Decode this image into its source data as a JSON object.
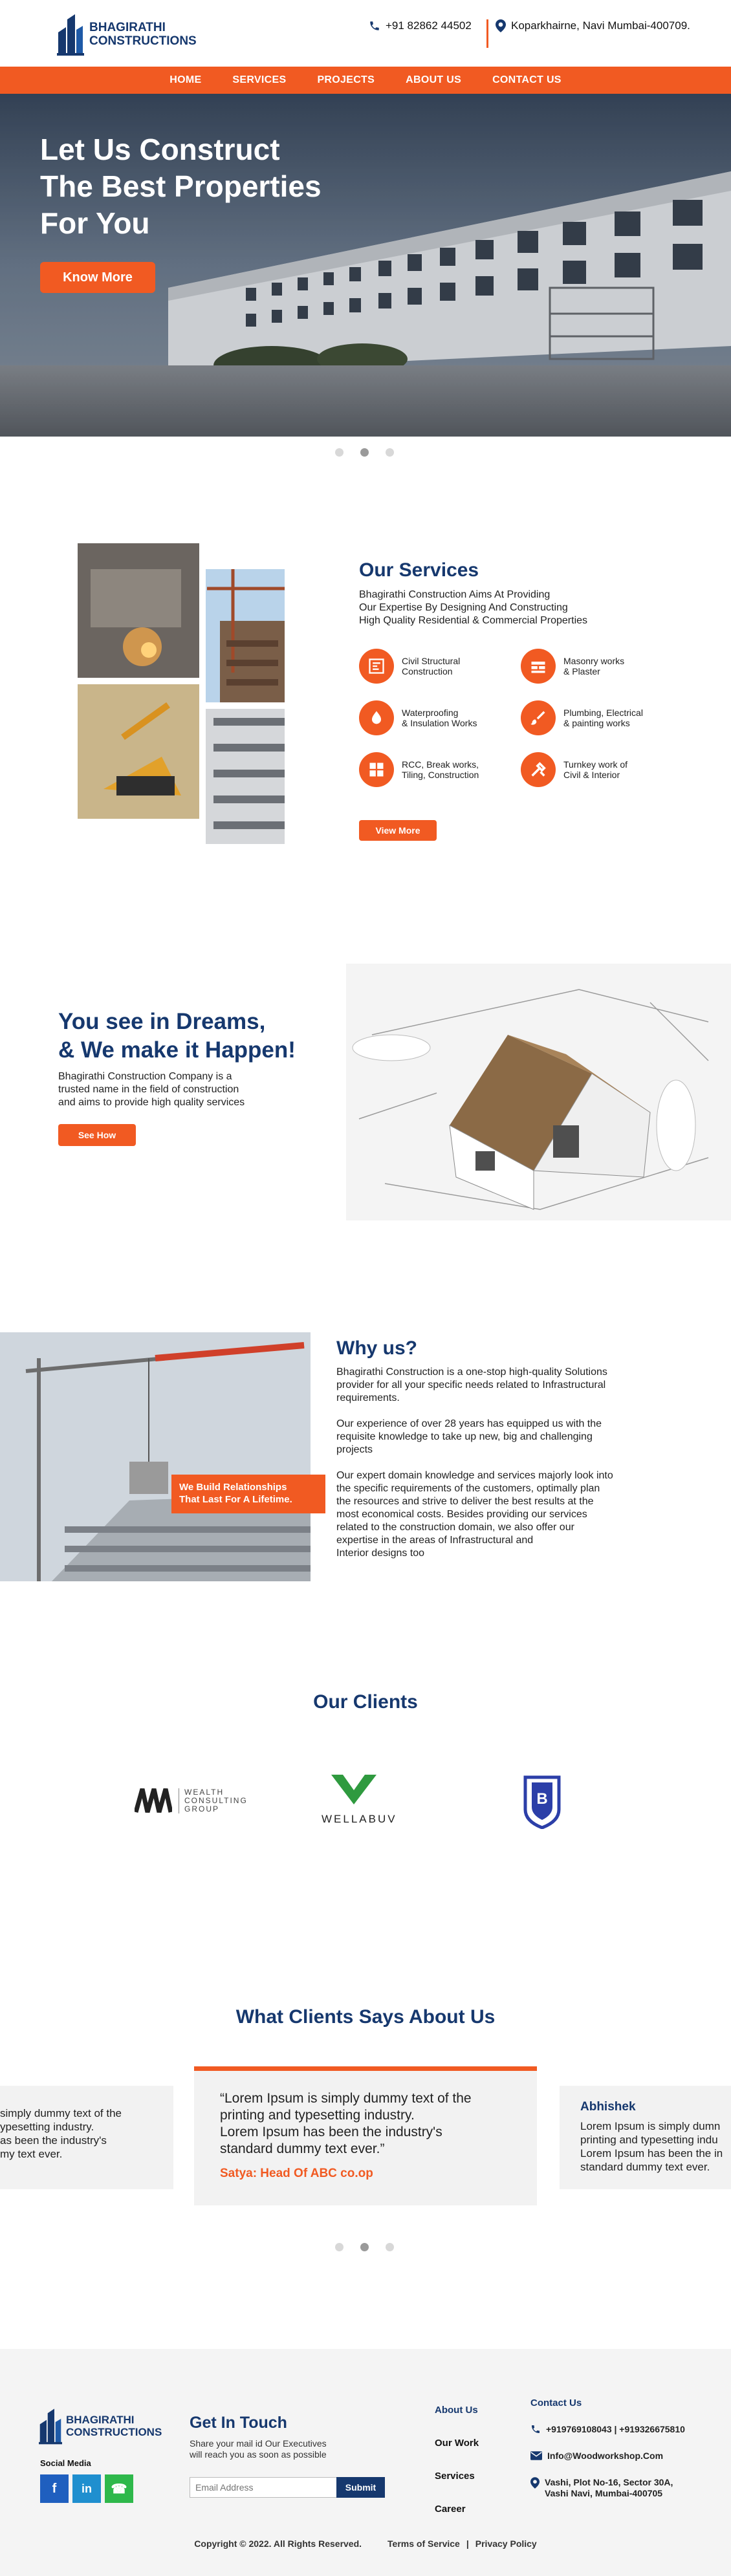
{
  "header": {
    "brand_line1": "BHAGIRATHI",
    "brand_line2": "CONSTRUCTIONS",
    "phone": "+91 82862 44502",
    "location": "Koparkhairne, Navi Mumbai-400709."
  },
  "nav": [
    "HOME",
    "SERVICES",
    "PROJECTS",
    "ABOUT US",
    "CONTACT US"
  ],
  "hero": {
    "title_lines": [
      "Let Us Construct",
      "The Best Properties",
      "For You"
    ],
    "cta": "Know More",
    "slides": 3,
    "active_slide": 2
  },
  "services": {
    "title": "Our Services",
    "intro_lines": [
      "Bhagirathi Construction Aims At Providing",
      "Our Expertise By Designing And Constructing",
      "High Quality Residential & Commercial Properties"
    ],
    "items": [
      {
        "label_lines": [
          "Civil Structural",
          "Construction"
        ],
        "icon": "blueprint-icon"
      },
      {
        "label_lines": [
          "Masonry works",
          "& Plaster"
        ],
        "icon": "brick-icon"
      },
      {
        "label_lines": [
          "Waterproofing",
          "& Insulation Works"
        ],
        "icon": "waterproof-icon"
      },
      {
        "label_lines": [
          "Plumbing, Electrical",
          "& painting works"
        ],
        "icon": "paint-brush-icon"
      },
      {
        "label_lines": [
          "RCC, Break works,",
          "Tiling, Construction"
        ],
        "icon": "tiles-icon"
      },
      {
        "label_lines": [
          "Turnkey work of",
          "Civil & Interior"
        ],
        "icon": "tools-icon"
      }
    ],
    "cta": "View More"
  },
  "dreams": {
    "title_lines": [
      "You see in Dreams,",
      "& We make it Happen!"
    ],
    "text_lines": [
      "Bhagirathi Construction Company is a",
      "trusted name in the field of construction",
      "and aims to provide high quality services"
    ],
    "cta": "See How"
  },
  "why": {
    "title": "Why us?",
    "badge_lines": [
      "We Build Relationships",
      "That Last For A Lifetime."
    ],
    "paragraphs": [
      [
        "Bhagirathi Construction is a one-stop high-quality Solutions",
        "provider for all your specific needs related to Infrastructural",
        "requirements."
      ],
      [
        "Our experience of over 28 years has equipped us with the",
        "requisite knowledge to take up new, big and challenging",
        "projects"
      ],
      [
        "Our expert domain knowledge and services majorly look into",
        "the specific requirements of the customers, optimally plan",
        "the resources and strive to deliver the best results at the",
        "most economical costs. Besides providing our services",
        "related to the construction domain, we also offer our",
        "expertise in the areas of Infrastructural and",
        "Interior designs too"
      ]
    ]
  },
  "clients": {
    "title": "Our Clients",
    "logos": [
      {
        "name_lines": [
          "WEALTH",
          "CONSULTING",
          "GROUP"
        ]
      },
      {
        "name": "WELLABUV"
      },
      {
        "letter": "B"
      }
    ]
  },
  "testimonials": {
    "title": "What Clients Says About Us",
    "left_partial_lines": [
      "simply dummy text of the",
      "ypesetting industry.",
      "as been the industry's",
      "my text ever."
    ],
    "center": {
      "quote_lines": [
        "“Lorem Ipsum is simply dummy text of the",
        "printing and typesetting industry.",
        "Lorem Ipsum has been the industry's",
        "standard dummy text ever.”"
      ],
      "author": "Satya: Head Of ABC co.op"
    },
    "right": {
      "name": "Abhishek",
      "text_lines": [
        "Lorem Ipsum is simply dumn",
        "printing and typesetting indu",
        "Lorem Ipsum has been the in",
        "standard dummy text ever."
      ]
    },
    "slides": 3,
    "active_slide": 2
  },
  "footer": {
    "brand_line1": "BHAGIRATHI",
    "brand_line2": "CONSTRUCTIONS",
    "social_label": "Social Media",
    "social": [
      {
        "glyph": "f",
        "color": "#1f5fbf",
        "icon": "facebook-icon"
      },
      {
        "glyph": "in",
        "color": "#1f8fcf",
        "icon": "linkedin-icon"
      },
      {
        "glyph": "☎",
        "color": "#2eb84b",
        "icon": "whatsapp-icon"
      }
    ],
    "touch_title": "Get In Touch",
    "touch_text_lines": [
      "Share your mail id Our Executives",
      "will reach you as soon as possible"
    ],
    "email_placeholder": "Email Address",
    "submit": "Submit",
    "links": [
      "About Us",
      "Our Work",
      "Services",
      "Career"
    ],
    "contact_title": "Contact Us",
    "contact_phone": "+919769108043 | +919326675810",
    "contact_email": "Info@Woodworkshop.Com",
    "contact_address_lines": [
      "Vashi, Plot No-16, Sector 30A,",
      "Vashi Navi, Mumbai-400705"
    ],
    "copyright": "Copyright © 2022. All Rights Reserved.",
    "terms": "Terms of Service",
    "sep": "|",
    "privacy": "Privacy Policy"
  },
  "colors": {
    "accent": "#f15a22",
    "brand": "#16386e"
  }
}
